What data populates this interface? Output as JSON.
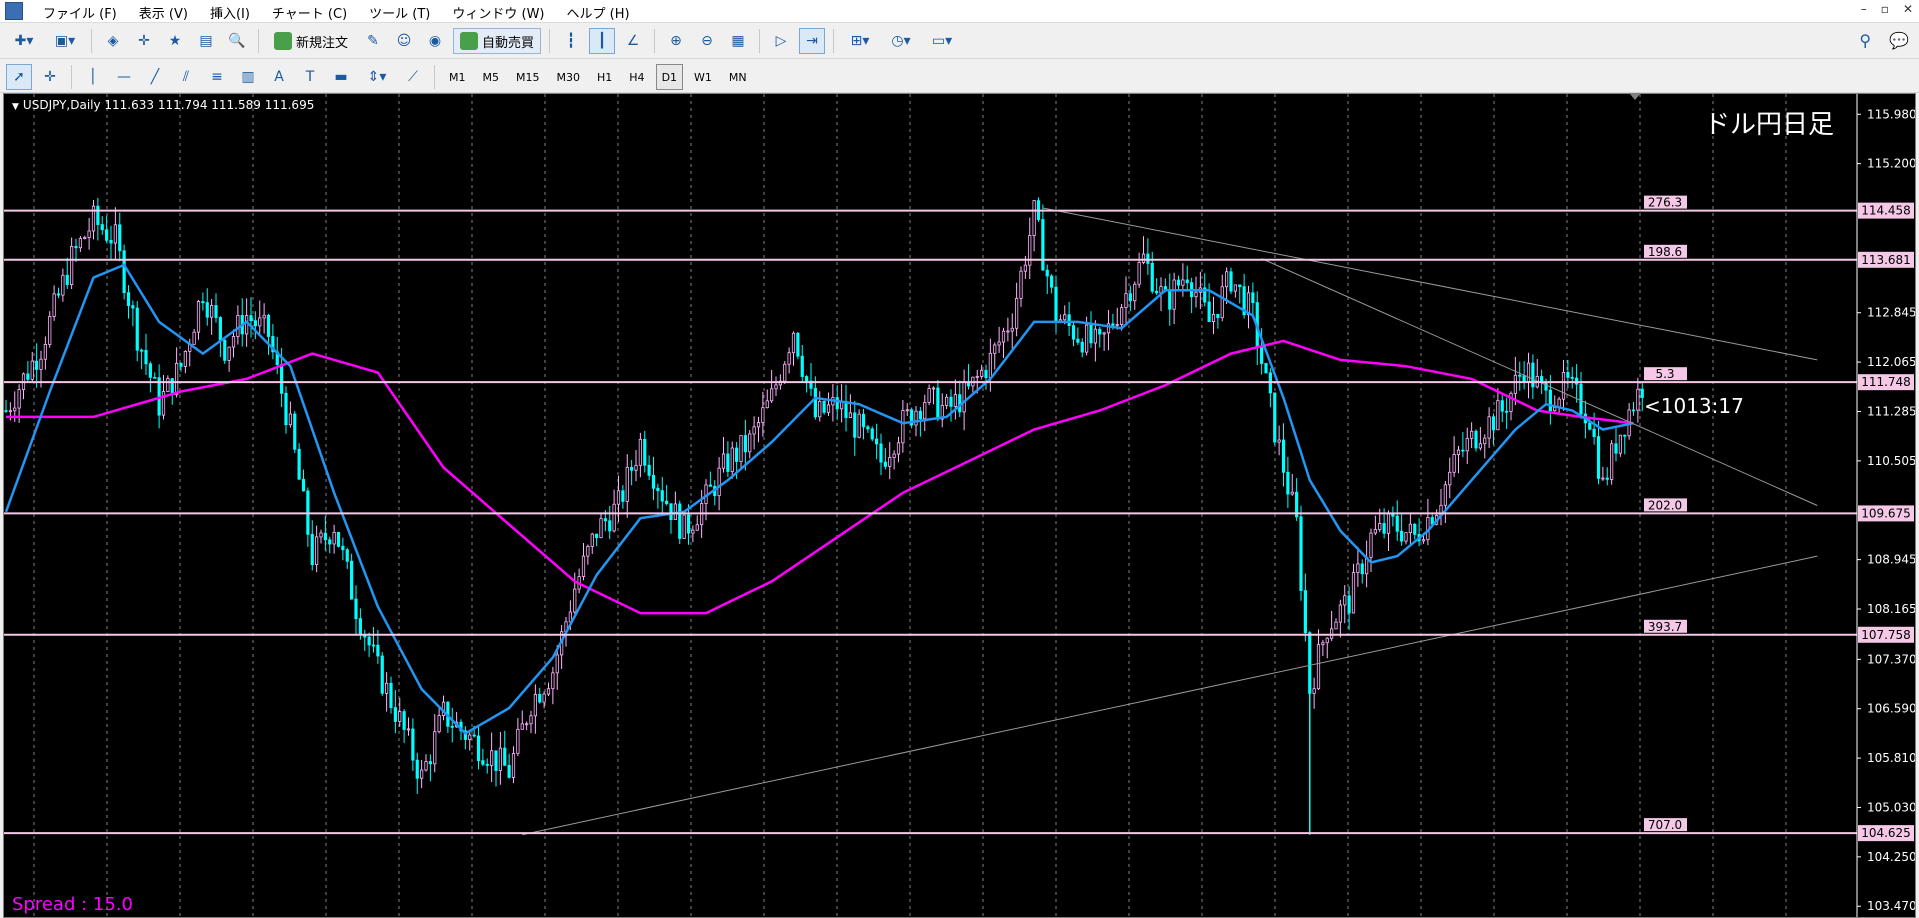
{
  "menu": [
    "ファイル (F)",
    "表示 (V)",
    "挿入(I)",
    "チャート (C)",
    "ツール (T)",
    "ウィンドウ (W)",
    "ヘルプ (H)"
  ],
  "toolbar": {
    "new_order": "新規注文",
    "auto_trading": "自動売買",
    "timeframes": [
      "M1",
      "M5",
      "M15",
      "M30",
      "H1",
      "H4",
      "D1",
      "W1",
      "MN"
    ],
    "active_timeframe": "D1"
  },
  "chart": {
    "symbol_line": "USDJPY,Daily  111.633 111.794 111.589 111.695",
    "title": "ドル円日足",
    "countdown": "<1013:17",
    "spread": "Spread : 15.0",
    "colors": {
      "background": "#000000",
      "candle_up": "#ffb4ff",
      "candle_down": "#00ffff",
      "ma_short": "#2196f3",
      "ma_long": "#ff00ff",
      "level": "#f4c8e6"
    }
  },
  "chart_data": {
    "type": "candlestick",
    "symbol": "USDJPY",
    "timeframe": "Daily",
    "last_bar": {
      "open": 111.633,
      "high": 111.794,
      "low": 111.589,
      "close": 111.695
    },
    "y_ticks": [
      115.98,
      115.2,
      114.458,
      113.681,
      112.845,
      112.065,
      111.748,
      111.285,
      110.505,
      109.675,
      108.945,
      108.165,
      107.758,
      107.37,
      106.59,
      105.81,
      105.03,
      104.625,
      104.25,
      103.47
    ],
    "y_tick_labels": [
      "115.980",
      "115.200",
      "114.458",
      "113.681",
      "112.845",
      "112.065",
      "111.748",
      "111.285",
      "110.505",
      "109.675",
      "108.945",
      "108.165",
      "107.758",
      "107.370",
      "106.590",
      "105.810",
      "105.030",
      "104.625",
      "104.250",
      "103.470"
    ],
    "ylim": [
      103.3,
      116.3
    ],
    "levels": [
      {
        "price": 114.458,
        "price_label": "114.458",
        "distance": "276.3"
      },
      {
        "price": 113.681,
        "price_label": "113.681",
        "distance": "198.6"
      },
      {
        "price": 111.748,
        "price_label": "111.748",
        "distance": "5.3"
      },
      {
        "price": 109.675,
        "price_label": "109.675",
        "distance": "202.0"
      },
      {
        "price": 107.758,
        "price_label": "107.758",
        "distance": "393.7"
      },
      {
        "price": 104.625,
        "price_label": "104.625",
        "distance": "707.0"
      }
    ],
    "bar_count": 270,
    "price_path": [
      [
        0,
        111.3
      ],
      [
        8,
        112.3
      ],
      [
        15,
        113.7
      ],
      [
        20,
        114.3
      ],
      [
        25,
        114.0
      ],
      [
        30,
        112.5
      ],
      [
        35,
        111.4
      ],
      [
        40,
        112.0
      ],
      [
        45,
        113.2
      ],
      [
        50,
        112.3
      ],
      [
        55,
        112.8
      ],
      [
        60,
        112.5
      ],
      [
        65,
        111.0
      ],
      [
        70,
        109.0
      ],
      [
        75,
        109.5
      ],
      [
        80,
        108.2
      ],
      [
        85,
        107.2
      ],
      [
        90,
        106.4
      ],
      [
        95,
        105.5
      ],
      [
        100,
        106.5
      ],
      [
        105,
        106.2
      ],
      [
        110,
        105.9
      ],
      [
        115,
        105.6
      ],
      [
        120,
        106.7
      ],
      [
        125,
        107.2
      ],
      [
        130,
        108.5
      ],
      [
        135,
        109.4
      ],
      [
        140,
        109.8
      ],
      [
        145,
        110.8
      ],
      [
        150,
        110.0
      ],
      [
        155,
        109.4
      ],
      [
        160,
        109.9
      ],
      [
        165,
        110.5
      ],
      [
        170,
        110.8
      ],
      [
        175,
        111.5
      ],
      [
        180,
        112.6
      ],
      [
        185,
        111.2
      ],
      [
        190,
        111.4
      ],
      [
        195,
        111.0
      ],
      [
        200,
        110.5
      ],
      [
        205,
        111.1
      ],
      [
        210,
        111.5
      ],
      [
        215,
        111.3
      ],
      [
        220,
        111.6
      ],
      [
        225,
        112.1
      ],
      [
        230,
        112.8
      ],
      [
        235,
        114.4
      ],
      [
        240,
        112.8
      ],
      [
        245,
        112.5
      ],
      [
        250,
        112.3
      ],
      [
        255,
        113.0
      ],
      [
        260,
        113.7
      ],
      [
        265,
        113.0
      ],
      [
        270,
        113.5
      ],
      [
        275,
        112.7
      ],
      [
        280,
        113.4
      ],
      [
        285,
        112.8
      ],
      [
        290,
        111.0
      ],
      [
        295,
        109.5
      ],
      [
        298,
        106.9
      ],
      [
        302,
        107.9
      ],
      [
        307,
        108.3
      ],
      [
        312,
        109.3
      ],
      [
        317,
        109.5
      ],
      [
        322,
        109.3
      ],
      [
        327,
        109.8
      ],
      [
        332,
        110.6
      ],
      [
        337,
        111.0
      ],
      [
        342,
        111.3
      ],
      [
        347,
        112.0
      ],
      [
        352,
        111.5
      ],
      [
        357,
        111.7
      ],
      [
        362,
        111.2
      ],
      [
        365,
        110.1
      ],
      [
        368,
        110.8
      ],
      [
        371,
        111.3
      ],
      [
        374,
        111.7
      ]
    ],
    "ma_short_path": [
      [
        0,
        109.7
      ],
      [
        10,
        111.6
      ],
      [
        20,
        113.4
      ],
      [
        27,
        113.6
      ],
      [
        35,
        112.7
      ],
      [
        45,
        112.2
      ],
      [
        55,
        112.7
      ],
      [
        65,
        112.0
      ],
      [
        75,
        110.0
      ],
      [
        85,
        108.2
      ],
      [
        95,
        106.9
      ],
      [
        105,
        106.2
      ],
      [
        115,
        106.6
      ],
      [
        125,
        107.4
      ],
      [
        135,
        108.7
      ],
      [
        145,
        109.6
      ],
      [
        155,
        109.7
      ],
      [
        165,
        110.2
      ],
      [
        175,
        110.8
      ],
      [
        185,
        111.5
      ],
      [
        195,
        111.4
      ],
      [
        205,
        111.1
      ],
      [
        215,
        111.2
      ],
      [
        225,
        111.8
      ],
      [
        235,
        112.7
      ],
      [
        245,
        112.7
      ],
      [
        255,
        112.6
      ],
      [
        265,
        113.2
      ],
      [
        275,
        113.2
      ],
      [
        285,
        112.8
      ],
      [
        292,
        111.5
      ],
      [
        298,
        110.2
      ],
      [
        305,
        109.4
      ],
      [
        312,
        108.9
      ],
      [
        318,
        109.0
      ],
      [
        325,
        109.4
      ],
      [
        335,
        110.2
      ],
      [
        345,
        111.0
      ],
      [
        352,
        111.4
      ],
      [
        358,
        111.3
      ],
      [
        365,
        111.0
      ],
      [
        372,
        111.1
      ]
    ],
    "ma_long_path": [
      [
        0,
        111.2
      ],
      [
        20,
        111.2
      ],
      [
        40,
        111.6
      ],
      [
        55,
        111.8
      ],
      [
        70,
        112.2
      ],
      [
        85,
        111.9
      ],
      [
        100,
        110.4
      ],
      [
        115,
        109.5
      ],
      [
        130,
        108.6
      ],
      [
        145,
        108.1
      ],
      [
        160,
        108.1
      ],
      [
        175,
        108.6
      ],
      [
        190,
        109.3
      ],
      [
        205,
        110.0
      ],
      [
        220,
        110.5
      ],
      [
        235,
        111.0
      ],
      [
        250,
        111.3
      ],
      [
        265,
        111.7
      ],
      [
        280,
        112.2
      ],
      [
        292,
        112.4
      ],
      [
        305,
        112.1
      ],
      [
        320,
        112.0
      ],
      [
        335,
        111.8
      ],
      [
        350,
        111.3
      ],
      [
        360,
        111.2
      ],
      [
        372,
        111.1
      ]
    ],
    "trend_lines": [
      {
        "from": [
          237,
          114.5
        ],
        "to": [
          414,
          112.1
        ]
      },
      {
        "from": [
          287,
          113.7
        ],
        "to": [
          414,
          109.8
        ]
      },
      {
        "from": [
          118,
          104.6
        ],
        "to": [
          414,
          109.0
        ]
      }
    ]
  }
}
